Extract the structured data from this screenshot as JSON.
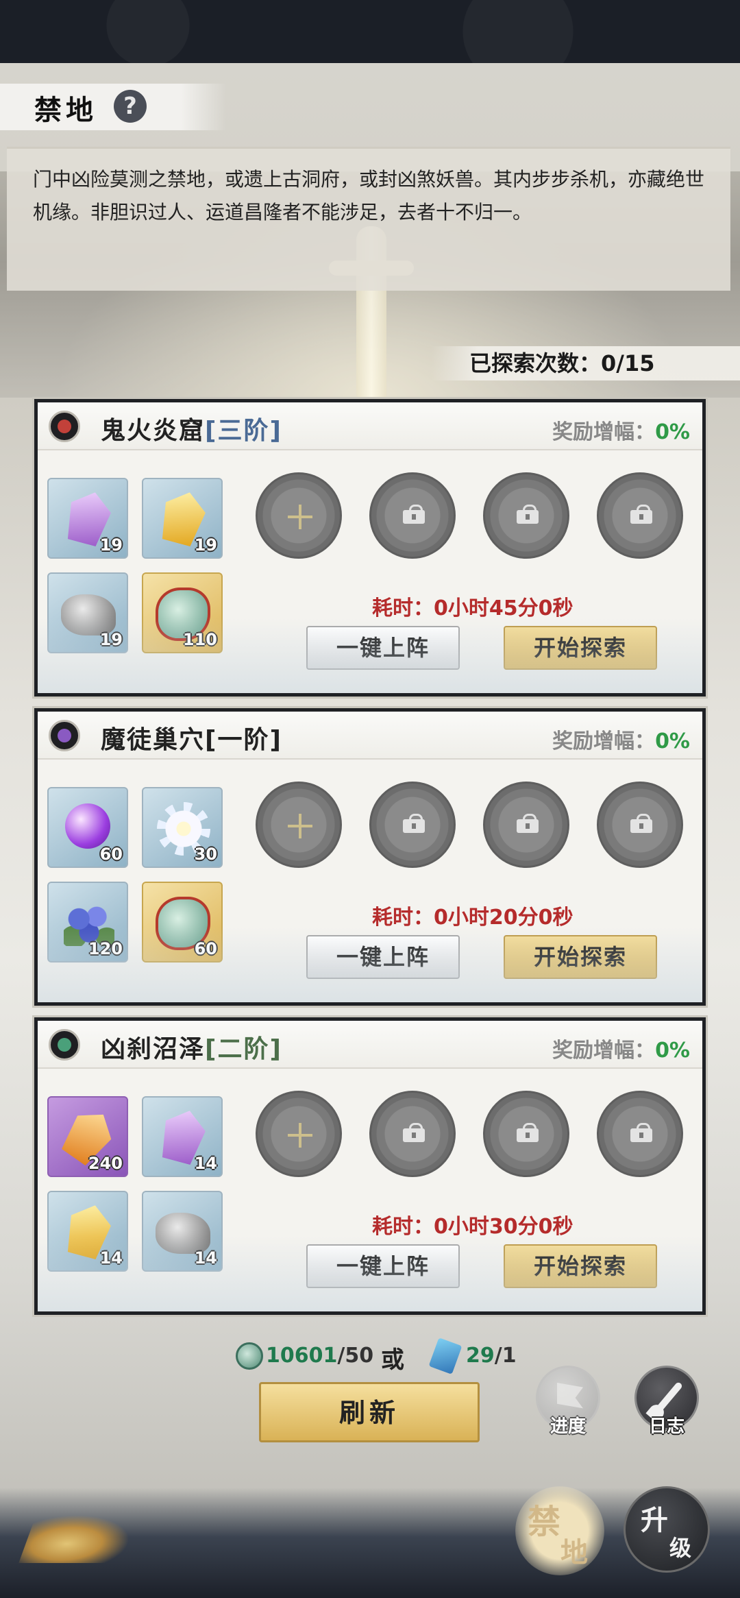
{
  "header": {
    "title": "禁地",
    "help_icon": "question-icon"
  },
  "description": "门中凶险莫测之禁地，或遗上古洞府，或封凶煞妖兽。其内步步杀机，亦藏绝世机缘。非胆识过人、运道昌隆者不能涉足，去者十不归一。",
  "explored": "已探索次数：0/15",
  "colors": {
    "accent_gold": "#ddb65a",
    "time_red": "#b52b2b",
    "bonus_green": "#2f9a47"
  },
  "cards": [
    {
      "name": "鬼火炎窟",
      "tier": "[三阶]",
      "bonus_label": "奖励增幅：",
      "bonus_value": "0%",
      "rewards": [
        {
          "icon": "purple-crystal-icon",
          "count": "19"
        },
        {
          "icon": "fire-crystal-icon",
          "count": "19"
        },
        {
          "icon": "stone-ore-icon",
          "count": "19"
        },
        {
          "icon": "jade-pendant-icon",
          "count": "110"
        }
      ],
      "time": "耗时：0小时45分0秒",
      "auto_label": "一键上阵",
      "start_label": "开始探索"
    },
    {
      "name": "魔徒巢穴",
      "tier": "[一阶]",
      "bonus_label": "奖励增幅：",
      "bonus_value": "0%",
      "rewards": [
        {
          "icon": "purple-orb-icon",
          "count": "60"
        },
        {
          "icon": "white-flower-icon",
          "count": "30"
        },
        {
          "icon": "blue-berries-icon",
          "count": "120"
        },
        {
          "icon": "jade-pendant-icon",
          "count": "60"
        }
      ],
      "time": "耗时：0小时20分0秒",
      "auto_label": "一键上阵",
      "start_label": "开始探索"
    },
    {
      "name": "凶刹沼泽",
      "tier": "[二阶]",
      "bonus_label": "奖励增幅：",
      "bonus_value": "0%",
      "rewards": [
        {
          "icon": "amber-crystal-icon",
          "count": "240"
        },
        {
          "icon": "purple-crystal-icon",
          "count": "14"
        },
        {
          "icon": "fire-crystal-icon",
          "count": "14"
        },
        {
          "icon": "stone-ore-icon",
          "count": "14"
        }
      ],
      "time": "耗时：0小时30分0秒",
      "auto_label": "一键上阵",
      "start_label": "开始探索"
    }
  ],
  "cost": {
    "jade_have": "10601",
    "jade_need": "/50",
    "or": "或",
    "token_have": "29",
    "token_need": "/1"
  },
  "refresh_label": "刷新",
  "progress_label": "进度",
  "log_label": "日志",
  "forbid_tab": {
    "c1": "禁",
    "c2": "地"
  },
  "upgrade_tab": {
    "c1": "升",
    "c2": "级"
  }
}
